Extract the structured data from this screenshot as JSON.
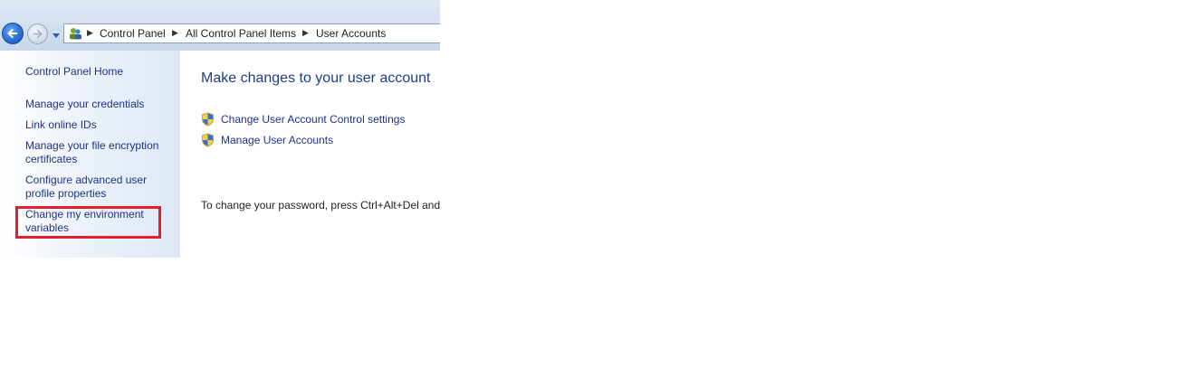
{
  "breadcrumb": {
    "items": [
      "Control Panel",
      "All Control Panel Items",
      "User Accounts"
    ]
  },
  "sidebar": {
    "home": "Control Panel Home",
    "links": [
      "Manage your credentials",
      "Link online IDs",
      "Manage your file encryption certificates",
      "Configure advanced user profile properties",
      "Change my environment variables"
    ]
  },
  "main": {
    "title": "Make changes to your user account",
    "tasks": [
      "Change User Account Control settings",
      "Manage User Accounts"
    ],
    "hint": "To change your password, press Ctrl+Alt+Del and"
  },
  "icons": {
    "back": "back-arrow-icon",
    "forward": "forward-arrow-icon",
    "history": "dropdown-arrow-icon",
    "location": "user-accounts-icon",
    "task": "uac-shield-icon"
  },
  "colors": {
    "link": "#1e3287",
    "title": "#1e3c8c",
    "highlight": "#e0202a"
  }
}
